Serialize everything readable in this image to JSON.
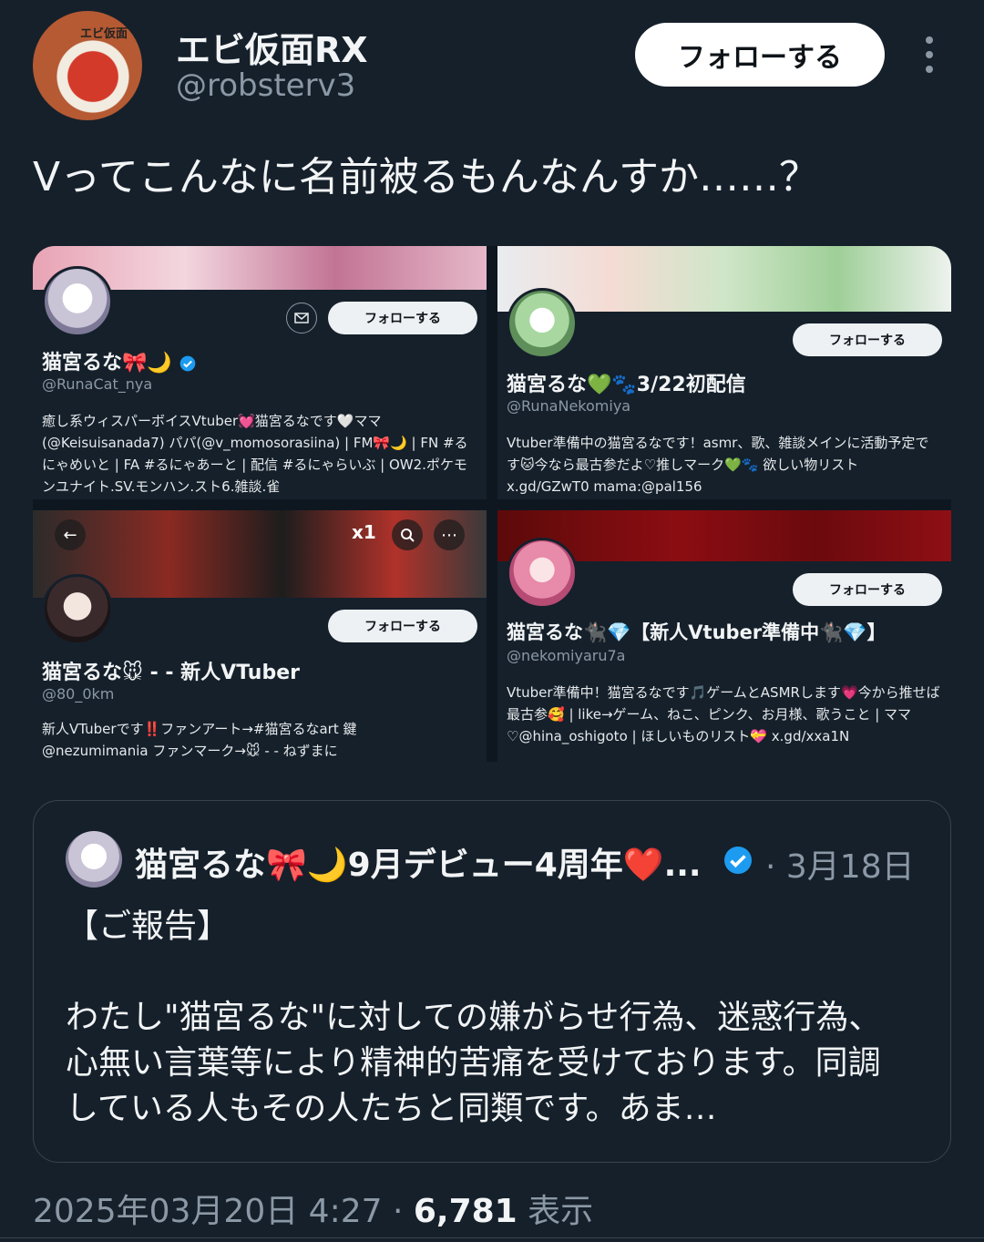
{
  "author": {
    "display_name": "エビ仮面RX",
    "handle": "@robsterv3",
    "avatar_text": "エビ仮面"
  },
  "follow_label": "フォローする",
  "tweet_text": "Vってこんなに名前被るもんなんすか……？",
  "cards": [
    {
      "name": "猫宮るな🎀🌙",
      "handle": "@RunaCat_nya",
      "follow": "フォローする",
      "bio": "癒し系ウィスパーボイスVtuber💓猫宮るなです🤍ママ(@Keisuisanada7) パパ(@v_momosorasiina) | FM🎀🌙 | FN #るにゃめいと | FA #るにゃあーと | 配信 #るにゃらいぶ | OW2.ポケモンユナイト.SV.モンハン.スト6.雑談.雀"
    },
    {
      "name": "猫宮るな💚🐾3/22初配信",
      "handle": "@RunaNekomiya",
      "follow": "フォローする",
      "bio": "Vtuber準備中の猫宮るなです！asmr、歌、雑談メインに活動予定です🐱今なら最古参だよ♡推しマーク💚🐾 欲しい物リスト x.gd/GZwT0 mama:@pal156"
    },
    {
      "name": "猫宮るな🐭 - - 新人VTuber",
      "handle": "@80_0km",
      "follow": "フォローする",
      "bio": "新人VTuberです‼️ファンアート→#猫宮るなart 鍵 @nezumimania ファンマーク→🐭 - - ねずまに"
    },
    {
      "name": "猫宮るな🐈‍⬛💎【新人Vtuber準備中🐈‍⬛💎】",
      "handle": "@nekomiyaru7a",
      "follow": "フォローする",
      "bio": "Vtuber準備中！猫宮るなです🎵ゲームとASMRします💗今から推せば最古参🥰 | like→ゲーム、ねこ、ピンク、お月様、歌うこと | ママ♡@hina_oshigoto | ほしいものリスト💝 x.gd/xxa1N"
    }
  ],
  "media_overlay": {
    "zoom": "x1"
  },
  "quote": {
    "name": "猫宮るな🎀🌙9月デビュー4周年❤️...",
    "date": "· 3月18日",
    "body": "【ご報告】\n\nわたし\"猫宮るな\"に対しての嫌がらせ行為、迷惑行為、心無い言葉等により精神的苦痛を受けております。同調している人もその人たちと同類です。あま…"
  },
  "footer": {
    "timestamp": "2025年03月20日 4:27 · ",
    "views": "6,781",
    "views_label": " 表示"
  },
  "colors": {
    "background": "#15202b",
    "verified": "#1d9bf0",
    "muted": "#8b98a5"
  }
}
